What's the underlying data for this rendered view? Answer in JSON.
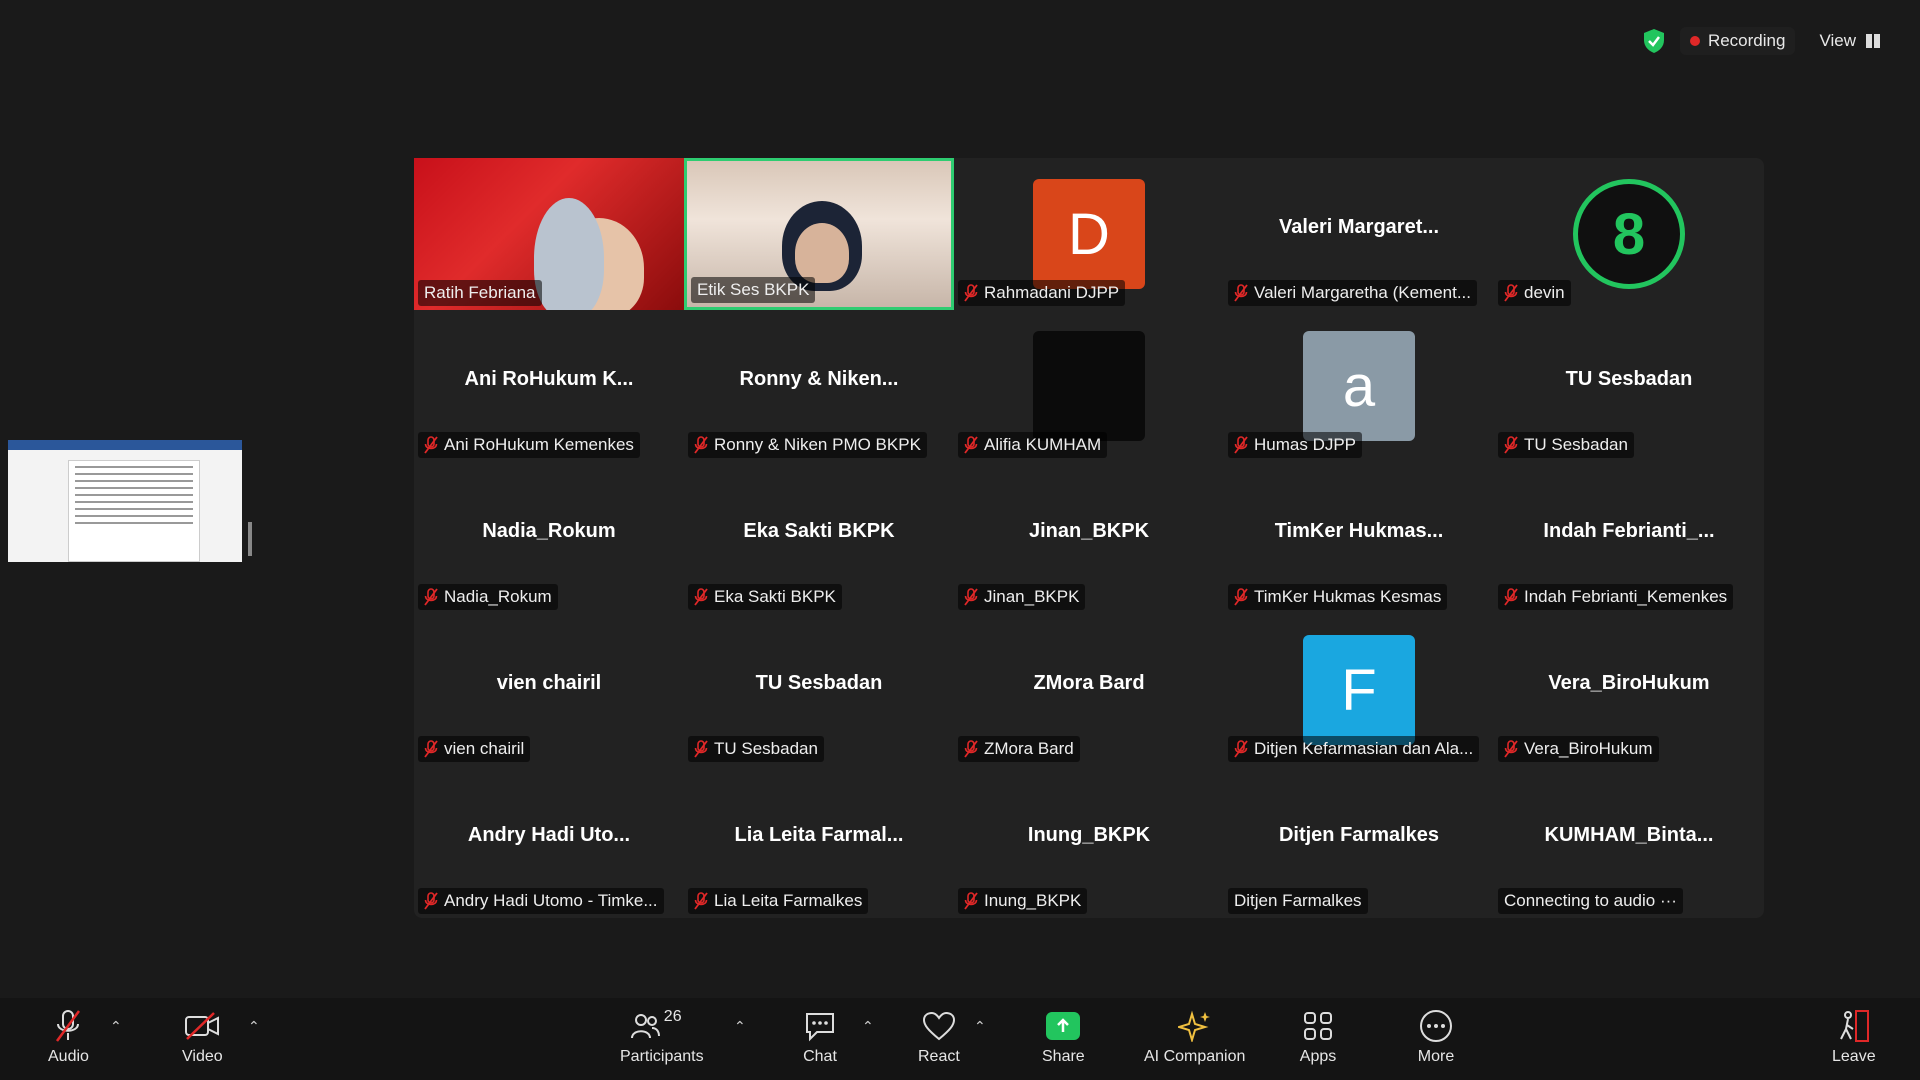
{
  "status": {
    "recording_label": "Recording",
    "view_label": "View",
    "colors": {
      "recording": "#e02828",
      "shield": "#22c55e",
      "active_speaker": "#2ecc71"
    }
  },
  "tiles": [
    {
      "center": "",
      "label": "Ratih Febriana",
      "muted": false,
      "kind": "video-ratih"
    },
    {
      "center": "",
      "label": "Etik Ses BKPK",
      "muted": false,
      "kind": "video-etik"
    },
    {
      "center": "",
      "avatar": "D",
      "avatar_color": "#d9461a",
      "label": "Rahmadani DJPP",
      "muted": true
    },
    {
      "center": "Valeri  Margaret...",
      "label": "Valeri Margaretha (Kement...",
      "muted": true
    },
    {
      "center": "",
      "avatar": "8",
      "avatar_color": "#101010",
      "label": "devin",
      "muted": true
    },
    {
      "center": "Ani RoHukum K...",
      "label": "Ani RoHukum Kemenkes",
      "muted": true
    },
    {
      "center": "Ronny & Niken...",
      "label": "Ronny & Niken PMO BKPK",
      "muted": true
    },
    {
      "center": "",
      "avatar": "",
      "avatar_color": "#0b0b0b",
      "label": "Alifia KUMHAM",
      "muted": true
    },
    {
      "center": "",
      "avatar": "a",
      "avatar_color": "#8a9aa6",
      "label": "Humas DJPP",
      "muted": true
    },
    {
      "center": "TU Sesbadan",
      "label": "TU Sesbadan",
      "muted": true
    },
    {
      "center": "Nadia_Rokum",
      "label": "Nadia_Rokum",
      "muted": true
    },
    {
      "center": "Eka Sakti BKPK",
      "label": "Eka Sakti BKPK",
      "muted": true
    },
    {
      "center": "Jinan_BKPK",
      "label": "Jinan_BKPK",
      "muted": true
    },
    {
      "center": "TimKer  Hukmas...",
      "label": "TimKer Hukmas Kesmas",
      "muted": true
    },
    {
      "center": "Indah  Febrianti_...",
      "label": "Indah Febrianti_Kemenkes",
      "muted": true
    },
    {
      "center": "vien chairil",
      "label": "vien chairil",
      "muted": true
    },
    {
      "center": "TU Sesbadan",
      "label": "TU Sesbadan",
      "muted": true
    },
    {
      "center": "ZMora Bard",
      "label": "ZMora Bard",
      "muted": true
    },
    {
      "center": "",
      "avatar": "F",
      "avatar_color": "#1aa7e0",
      "label": "Ditjen Kefarmasian dan Ala...",
      "muted": true
    },
    {
      "center": "Vera_BiroHukum",
      "label": "Vera_BiroHukum",
      "muted": true
    },
    {
      "center": "Andry Hadi Uto...",
      "label": "Andry Hadi Utomo - Timke...",
      "muted": true
    },
    {
      "center": "Lia Leita Farmal...",
      "label": "Lia Leita Farmalkes",
      "muted": true
    },
    {
      "center": "Inung_BKPK",
      "label": "Inung_BKPK",
      "muted": true
    },
    {
      "center": "Ditjen Farmalkes",
      "label": "Ditjen Farmalkes",
      "muted": false
    },
    {
      "center": "KUMHAM_Binta...",
      "label": "Connecting to audio ···",
      "muted": false
    }
  ],
  "toolbar": {
    "audio": "Audio",
    "video": "Video",
    "participants": "Participants",
    "participants_count": "26",
    "chat": "Chat",
    "react": "React",
    "share": "Share",
    "ai_companion": "AI Companion",
    "apps": "Apps",
    "more": "More",
    "leave": "Leave"
  }
}
